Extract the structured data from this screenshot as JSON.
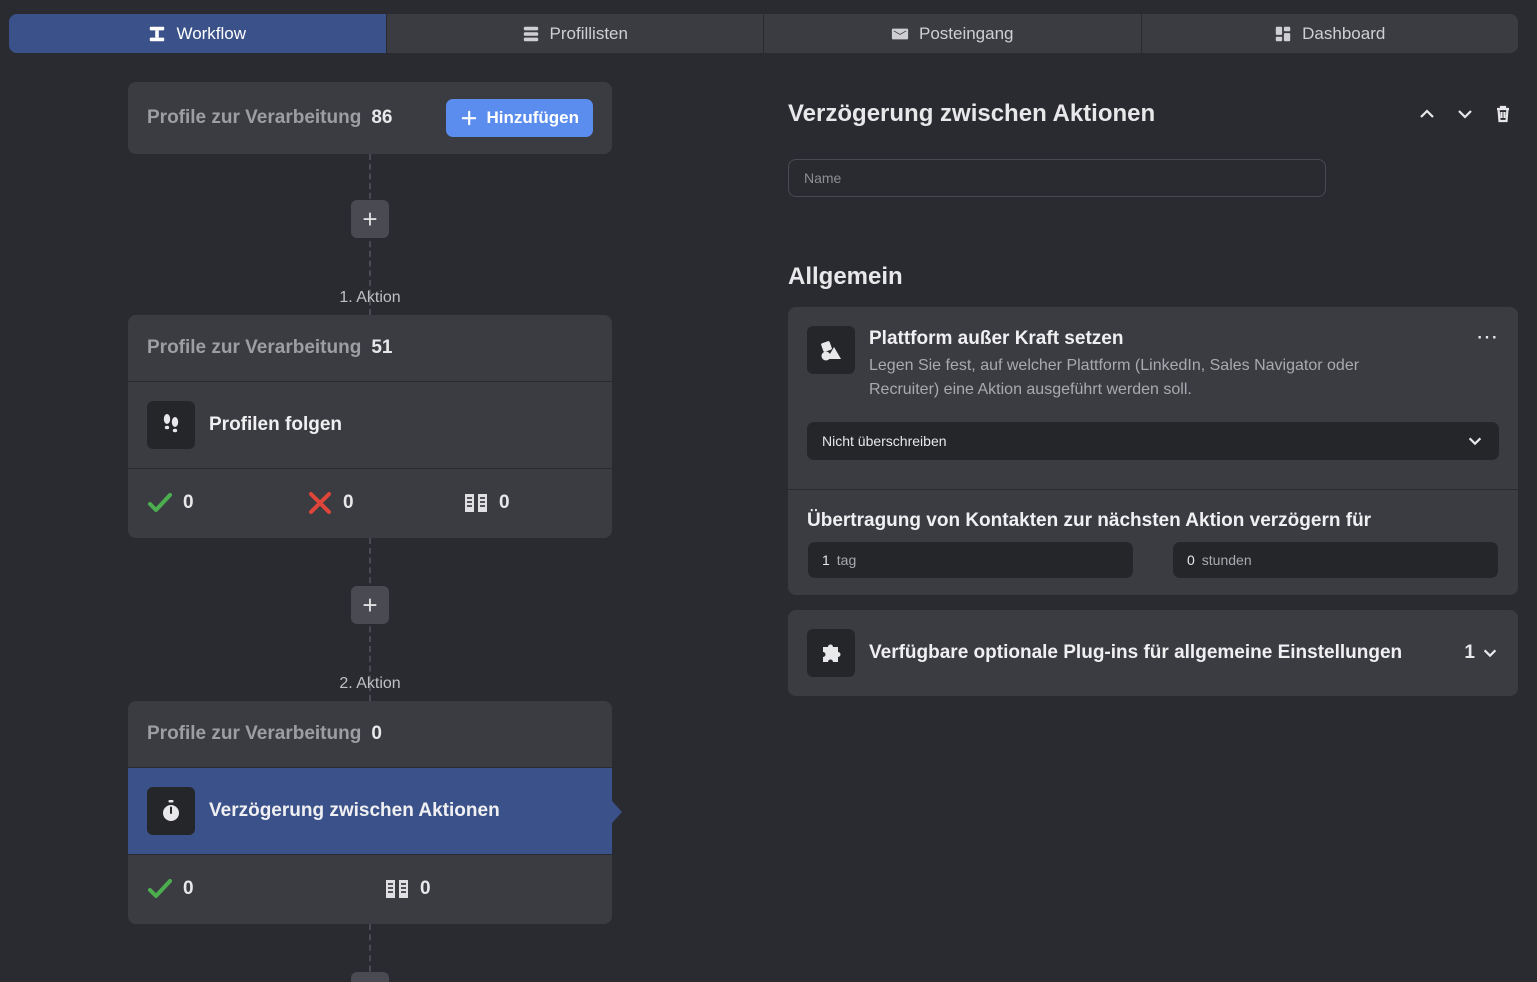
{
  "nav": {
    "tabs": [
      {
        "label": "Workflow",
        "icon": "workflow-icon",
        "active": true
      },
      {
        "label": "Profillisten",
        "icon": "list-icon",
        "active": false
      },
      {
        "label": "Posteingang",
        "icon": "mail-icon",
        "active": false
      },
      {
        "label": "Dashboard",
        "icon": "dashboard-icon",
        "active": false
      }
    ]
  },
  "flow": {
    "start": {
      "label": "Profile zur Verarbeitung",
      "count": "86",
      "add_label": "Hinzufügen"
    },
    "actions": [
      {
        "step_label": "1. Aktion",
        "profiles_label": "Profile zur Verarbeitung",
        "profiles_count": "51",
        "name": "Profilen folgen",
        "icon": "footsteps-icon",
        "success": "0",
        "failed": "0",
        "skipped": "0"
      },
      {
        "step_label": "2. Aktion",
        "profiles_label": "Profile zur Verarbeitung",
        "profiles_count": "0",
        "name": "Verzögerung zwischen Aktionen",
        "icon": "stopwatch-icon",
        "success": "0",
        "skipped": "0"
      }
    ]
  },
  "panel": {
    "title": "Verzögerung zwischen Aktionen",
    "name_placeholder": "Name",
    "section_title": "Allgemein",
    "platform": {
      "title": "Plattform außer Kraft setzen",
      "description": "Legen Sie fest, auf welcher Plattform (LinkedIn, Sales Navigator oder Recruiter) eine Aktion ausgeführt werden soll.",
      "selected": "Nicht überschreiben"
    },
    "delay": {
      "title": "Übertragung von Kontakten zur nächsten Aktion verzögern für",
      "days_value": "1",
      "days_unit": "tag",
      "hours_value": "0",
      "hours_unit": "stunden"
    },
    "plugins": {
      "label": "Verfügbare optionale Plug-ins für allgemeine Einstellungen",
      "count": "1"
    }
  },
  "colors": {
    "accent": "#3a5189",
    "button": "#5b8def",
    "success": "#4cae4f",
    "error": "#e0453a"
  }
}
